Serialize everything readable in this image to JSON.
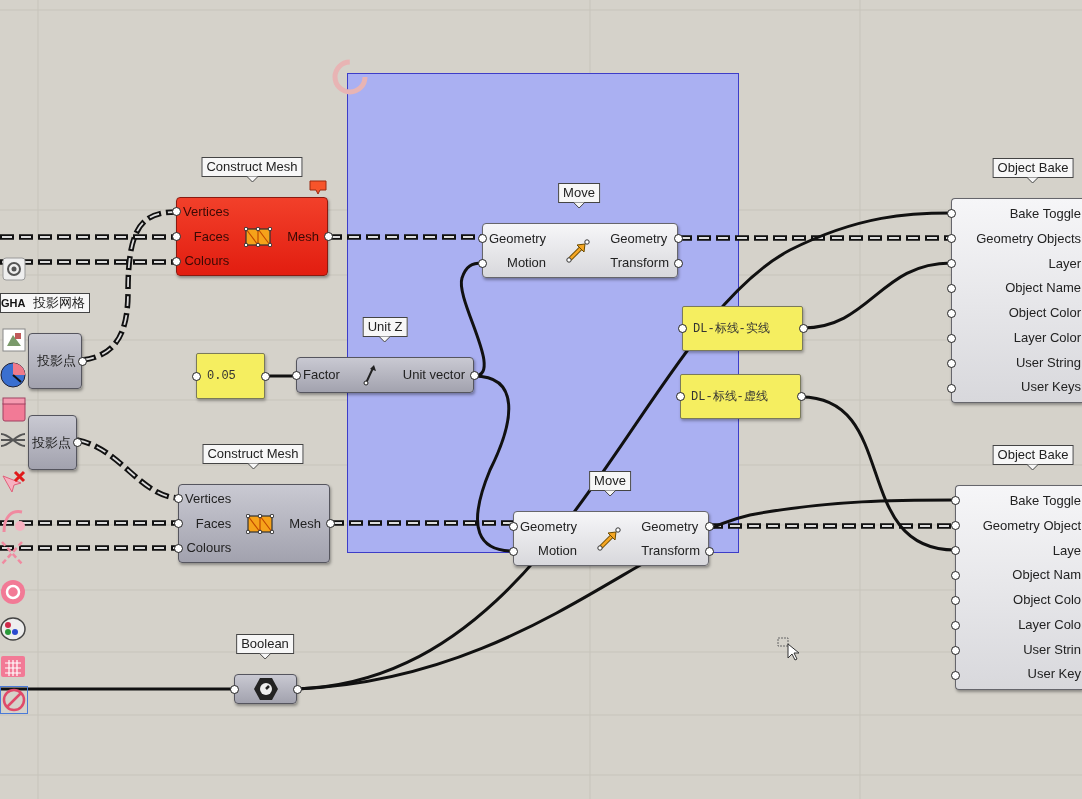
{
  "sidebar": {
    "badge": "GHA"
  },
  "nodes": [
    {
      "kind": "tag",
      "text": "投影网格"
    },
    {
      "kind": "mesh",
      "tag": "Construct Mesh",
      "error": true,
      "inputs": [
        "Vertices",
        "Faces",
        "Colours"
      ],
      "outputs": [
        "Mesh"
      ]
    },
    {
      "kind": "move",
      "tag": "Move",
      "error": false,
      "inputs": [
        "Geometry",
        "Motion"
      ],
      "outputs": [
        "Geometry",
        "Transform"
      ]
    },
    {
      "kind": "bake",
      "tag": "Object Bake",
      "error": false,
      "inputs": [
        "Bake Toggle",
        "Geometry Objects",
        "Layer",
        "Object Name",
        "Object Color",
        "Layer Color",
        "User String",
        "User Keys"
      ]
    },
    {
      "kind": "param",
      "text": "投影点"
    },
    {
      "kind": "panel",
      "text": "0.05"
    },
    {
      "kind": "unit-z",
      "tag": "Unit Z",
      "error": false,
      "inputs": [
        "Factor"
      ],
      "outputs": [
        "Unit vector"
      ]
    },
    {
      "kind": "panel",
      "text": "DL-标线-实线"
    },
    {
      "kind": "panel",
      "text": "DL-标线-虚线"
    },
    {
      "kind": "param",
      "text": "投影点"
    },
    {
      "kind": "mesh",
      "tag": "Construct Mesh",
      "error": false,
      "inputs": [
        "Vertices",
        "Faces",
        "Colours"
      ],
      "outputs": [
        "Mesh"
      ]
    },
    {
      "kind": "move",
      "tag": "Move",
      "error": false,
      "inputs": [
        "Geometry",
        "Motion"
      ],
      "outputs": [
        "Geometry",
        "Transform"
      ]
    },
    {
      "kind": "bake",
      "tag": "Object Bake",
      "error": false,
      "inputs": [
        "Bake Toggle",
        "Geometry Object",
        "Laye",
        "Object Nam",
        "Object Colo",
        "Layer Colo",
        "User Strin",
        "User Key"
      ]
    },
    {
      "kind": "toggle",
      "tag": "Boolean"
    }
  ]
}
